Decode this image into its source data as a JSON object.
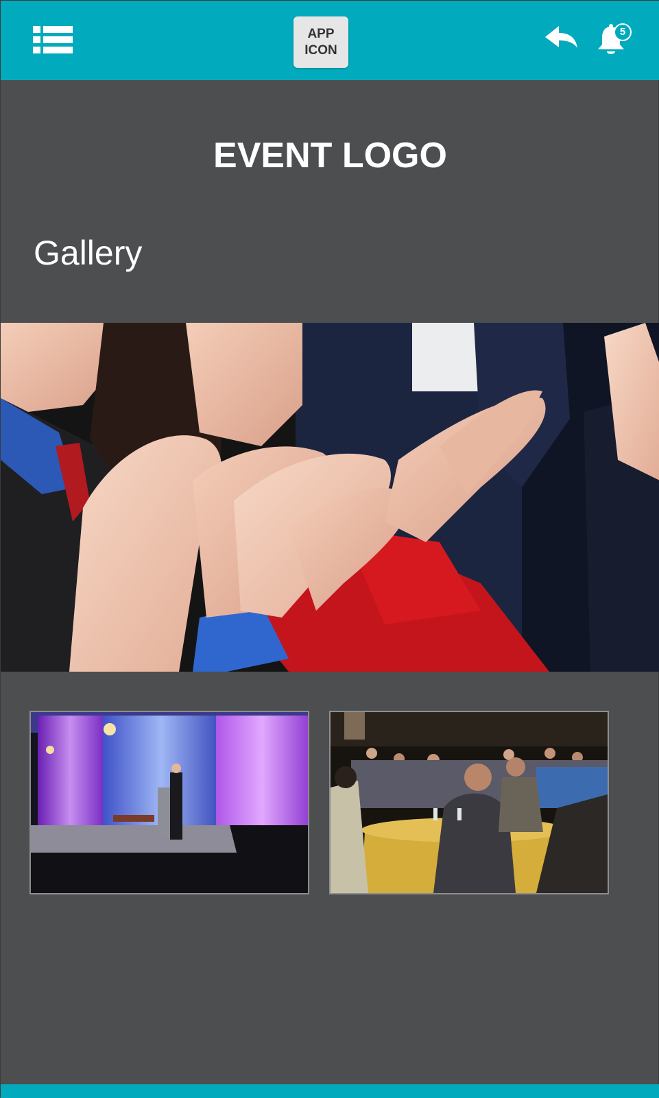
{
  "header": {
    "menu_icon": "list-menu-icon",
    "app_icon_label": "APP\nICON",
    "back_icon": "reply-arrow-icon",
    "bell_icon": "bell-icon",
    "notification_count": "5",
    "accent_color": "#01abbd"
  },
  "event": {
    "logo_text": "EVENT LOGO"
  },
  "gallery": {
    "title": "Gallery",
    "background_color": "#4d4e50"
  }
}
